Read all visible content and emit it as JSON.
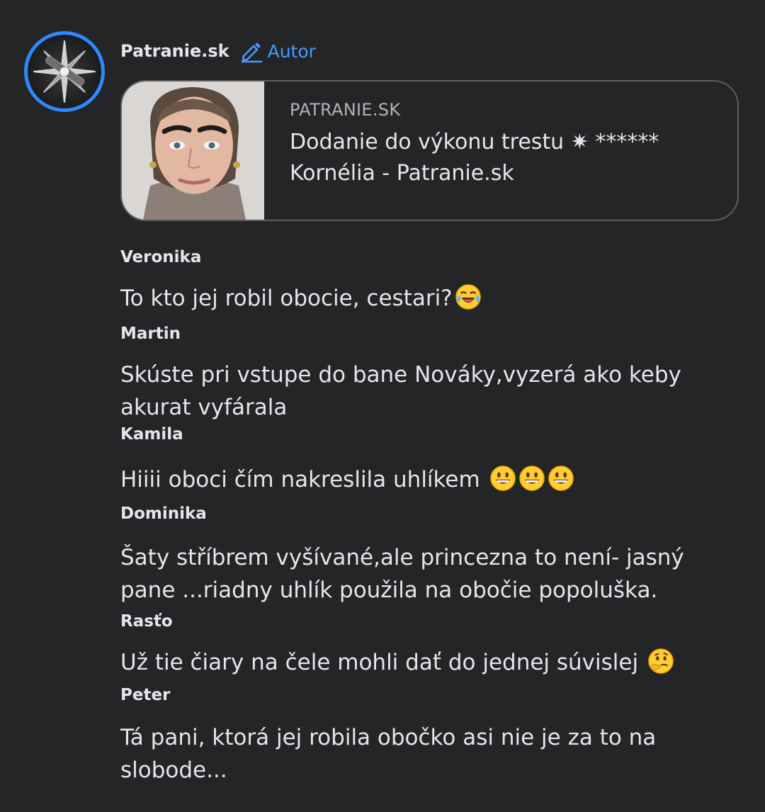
{
  "post": {
    "author": "Patranie.sk",
    "author_badge": "Autor",
    "avatar_icon": "compass-star-icon",
    "badge_icon": "pencil-icon"
  },
  "link_card": {
    "domain": "PATRANIE.SK",
    "title": "Dodanie do výkonu trestu ✷ ****** Kornélia - Patranie.sk",
    "image": "portrait-photo"
  },
  "comments": [
    {
      "name": "Veronika",
      "text": "To kto jej robil obocie, cestari?",
      "emoji": [
        "laughing-crying-emoji"
      ]
    },
    {
      "name": "Martin",
      "text": "Skúste pri vstupe do bane Nováky,vyzerá ako keby akurat vyfárala",
      "emoji": []
    },
    {
      "name": "Kamila",
      "text": "Hiiii oboci čím nakreslila uhlíkem ",
      "emoji": [
        "grinning-emoji",
        "grinning-emoji",
        "grinning-emoji"
      ]
    },
    {
      "name": "Dominika",
      "text": "Šaty stříbrem vyšívané,ale princezna to není- jasný pane ...riadny uhlík použila na obočie popoluška.",
      "emoji": []
    },
    {
      "name": "Rasťo",
      "text": "Už tie čiary na čele mohli dať do jednej súvislej ",
      "emoji": [
        "thinking-emoji"
      ]
    },
    {
      "name": "Peter",
      "text": "Tá pani, ktorá jej robila obočko asi nie je za to na slobode...",
      "emoji": []
    }
  ],
  "colors": {
    "background": "#242526",
    "accent": "#2d88ff",
    "badge": "#4599ff",
    "text": "#e4e6eb",
    "muted": "#b0b3b8"
  }
}
